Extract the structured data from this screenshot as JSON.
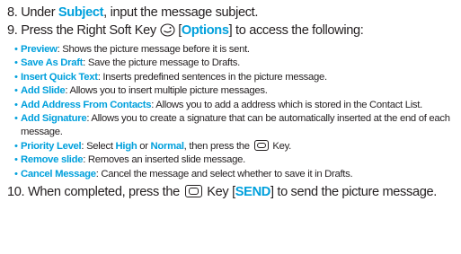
{
  "step8": {
    "num": "8.",
    "pre": "Under ",
    "kw": "Subject",
    "post": ", input the message subject."
  },
  "step9": {
    "num": "9.",
    "pre": "Press the Right Soft Key ",
    "bracket_open": " [",
    "kw": "Options",
    "post": "] to access the following:"
  },
  "options": [
    {
      "label": "Preview",
      "desc": ": Shows the picture message before it is sent."
    },
    {
      "label": "Save As Draft",
      "desc": ": Save the picture message to Drafts."
    },
    {
      "label": "Insert Quick Text",
      "desc": ": Inserts predefined sentences in the picture message."
    },
    {
      "label": "Add Slide",
      "desc": ": Allows you to insert multiple picture messages."
    },
    {
      "label": "Add Address From Contacts",
      "desc": ": Allows you to add a address which is stored in the Contact List."
    },
    {
      "label": "Add Signature",
      "desc": ": Allows you to create a signature that can be automatically inserted at the end of each message."
    },
    {
      "label": "Priority Level",
      "desc_pre": ": Select ",
      "kw1": "High",
      "mid": " or ",
      "kw2": "Normal",
      "desc_post": ", then press the ",
      "tail": " Key."
    },
    {
      "label": "Remove slide",
      "desc": ": Removes an inserted slide message."
    },
    {
      "label": "Cancel Message",
      "desc": ": Cancel the message and select whether to save it in Drafts."
    }
  ],
  "step10": {
    "num": "10.",
    "pre": "When completed, press the ",
    "mid": " Key [",
    "kw": "SEND",
    "post": "] to send the picture message."
  },
  "icons": {
    "soft_key": "right-soft-key-icon",
    "ok_key": "ok-key-icon"
  },
  "colors": {
    "accent": "#00a0dc",
    "text": "#231f20"
  }
}
